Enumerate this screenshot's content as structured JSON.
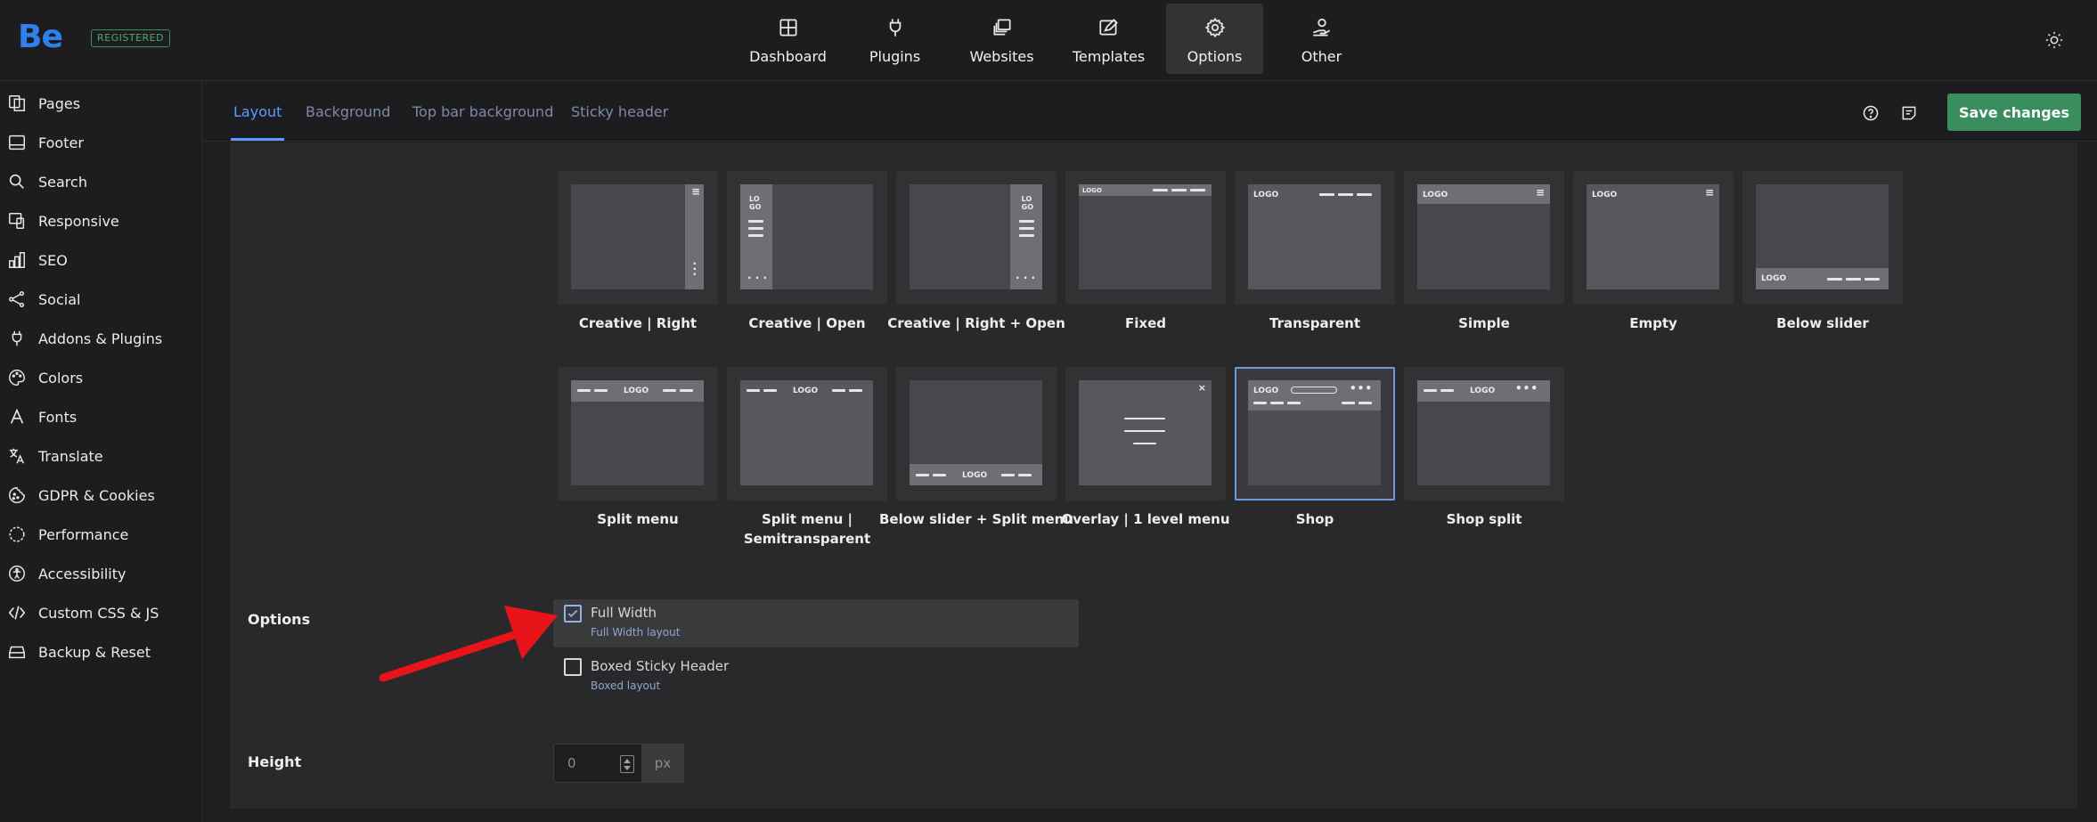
{
  "header": {
    "logo": "Be",
    "badge": "REGISTERED",
    "nav": [
      {
        "label": "Dashboard",
        "icon": "dashboard-icon"
      },
      {
        "label": "Plugins",
        "icon": "plug-icon"
      },
      {
        "label": "Websites",
        "icon": "websites-icon"
      },
      {
        "label": "Templates",
        "icon": "templates-icon"
      },
      {
        "label": "Options",
        "icon": "gear-icon",
        "active": true
      },
      {
        "label": "Other",
        "icon": "user-hand-icon"
      }
    ],
    "theme_toggle_icon": "sun-icon"
  },
  "sidebar": {
    "items": [
      {
        "label": "Pages",
        "icon": "pages-icon"
      },
      {
        "label": "Footer",
        "icon": "footer-icon"
      },
      {
        "label": "Search",
        "icon": "search-icon"
      },
      {
        "label": "Responsive",
        "icon": "responsive-icon"
      },
      {
        "label": "SEO",
        "icon": "seo-chart-icon"
      },
      {
        "label": "Social",
        "icon": "share-icon"
      },
      {
        "label": "Addons & Plugins",
        "icon": "plug-icon"
      },
      {
        "label": "Colors",
        "icon": "palette-icon"
      },
      {
        "label": "Fonts",
        "icon": "font-icon"
      },
      {
        "label": "Translate",
        "icon": "translate-icon"
      },
      {
        "label": "GDPR & Cookies",
        "icon": "cookie-icon"
      },
      {
        "label": "Performance",
        "icon": "gauge-icon"
      },
      {
        "label": "Accessibility",
        "icon": "accessibility-icon"
      },
      {
        "label": "Custom CSS & JS",
        "icon": "code-icon"
      },
      {
        "label": "Backup & Reset",
        "icon": "backup-icon"
      }
    ]
  },
  "tabs": [
    {
      "label": "Layout",
      "active": true
    },
    {
      "label": "Background"
    },
    {
      "label": "Top bar background"
    },
    {
      "label": "Sticky header"
    }
  ],
  "toolbar": {
    "help_icon": "help-circle-icon",
    "notes_icon": "notes-icon",
    "save_label": "Save changes"
  },
  "layouts": {
    "row1": [
      {
        "label": "Creative | Right"
      },
      {
        "label": "Creative | Open"
      },
      {
        "label": "Creative | Right + Open"
      },
      {
        "label": "Fixed"
      },
      {
        "label": "Transparent"
      },
      {
        "label": "Simple"
      },
      {
        "label": "Empty"
      },
      {
        "label": "Below slider"
      }
    ],
    "row2": [
      {
        "label": "Split menu"
      },
      {
        "label": "Split menu | Semitransparent"
      },
      {
        "label": "Below slider + Split menu"
      },
      {
        "label": "Overlay | 1 level menu"
      },
      {
        "label": "Shop",
        "selected": true
      },
      {
        "label": "Shop split"
      }
    ],
    "thumb_logo_text": "LOGO",
    "thumb_logo_stack": "LO\nGO"
  },
  "options": {
    "label": "Options",
    "items": [
      {
        "title": "Full Width",
        "subtitle": "Full Width layout",
        "checked": true
      },
      {
        "title": "Boxed Sticky Header",
        "subtitle": "Boxed layout",
        "checked": false
      }
    ]
  },
  "height": {
    "label": "Height",
    "value": "0",
    "unit": "px"
  },
  "colors": {
    "accent": "#5b9bff",
    "save": "#3a8d5d",
    "arrow": "#e8141a",
    "badge": "#4ea873"
  }
}
